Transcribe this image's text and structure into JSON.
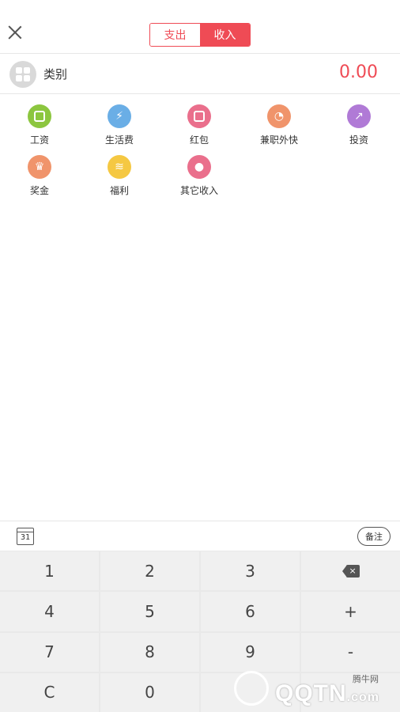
{
  "header": {
    "tabs": [
      {
        "label": "支出",
        "active": false
      },
      {
        "label": "收入",
        "active": true
      }
    ]
  },
  "category": {
    "label": "类别",
    "amount": "0.00"
  },
  "categories": [
    {
      "label": "工资",
      "icon": "salary-icon",
      "color": "#8cc63f"
    },
    {
      "label": "生活费",
      "icon": "living-expense-icon",
      "color": "#6aaee6"
    },
    {
      "label": "红包",
      "icon": "red-envelope-icon",
      "color": "#ea6f8c"
    },
    {
      "label": "兼职外快",
      "icon": "part-time-icon",
      "color": "#f0946b"
    },
    {
      "label": "投资",
      "icon": "investment-icon",
      "color": "#b07ad6"
    },
    {
      "label": "奖金",
      "icon": "bonus-icon",
      "color": "#f0946b"
    },
    {
      "label": "福利",
      "icon": "welfare-icon",
      "color": "#f5c842"
    },
    {
      "label": "其它收入",
      "icon": "other-income-icon",
      "color": "#ea6f8c"
    }
  ],
  "toolbar": {
    "calendar_day": "31",
    "note_label": "备注"
  },
  "keypad": {
    "keys": [
      "1",
      "2",
      "3",
      "⌫",
      "4",
      "5",
      "6",
      "+",
      "7",
      "8",
      "9",
      "-",
      "C",
      "0",
      "",
      ""
    ]
  },
  "watermark": {
    "brand": "QQTN",
    "suffix": ".com",
    "site": "腾牛网"
  },
  "colors": {
    "accent": "#ef4b55",
    "divider": "#e6e6e6",
    "key_bg": "#f0f0f0"
  }
}
